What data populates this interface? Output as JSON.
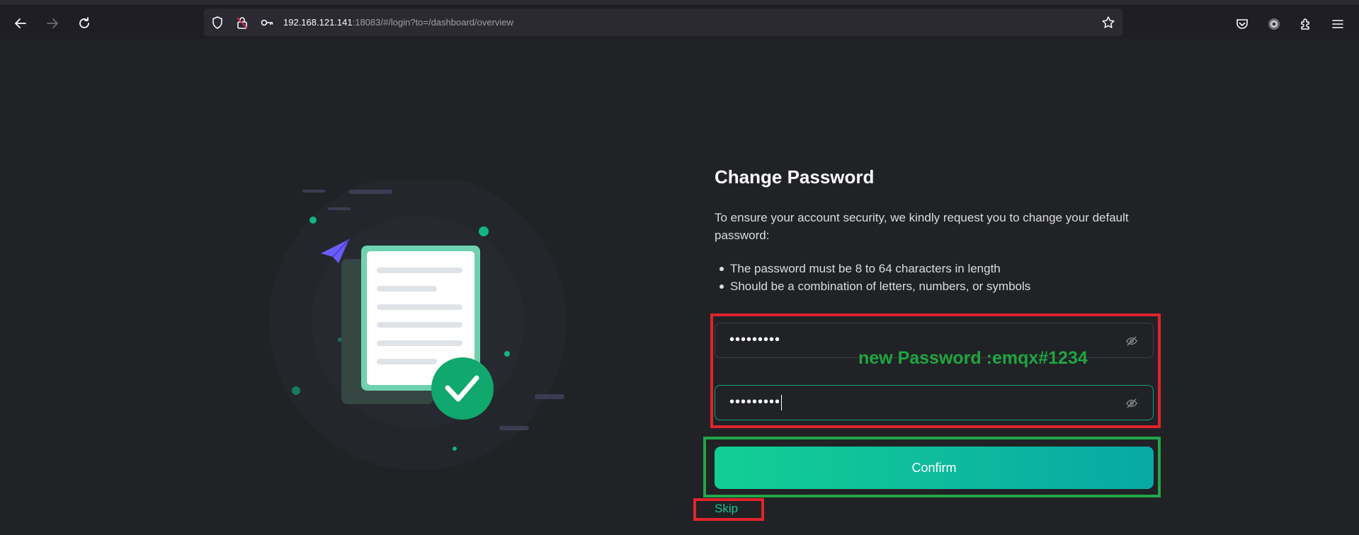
{
  "browser": {
    "url_host": "192.168.121.141",
    "url_rest": ":18083/#/login?to=/dashboard/overview",
    "icons": {
      "back": "back-arrow-icon",
      "forward": "forward-arrow-icon",
      "reload": "reload-icon",
      "shield": "shield-icon",
      "lock": "lock-icon",
      "key": "key-icon",
      "bookmark": "star-icon",
      "pocket": "pocket-icon",
      "account": "account-icon",
      "extensions": "puzzle-icon",
      "menu": "hamburger-menu-icon"
    }
  },
  "page": {
    "title": "Change Password",
    "description": "To ensure your account security, we kindly request you to change your default password:",
    "rules": [
      "The password must be 8 to 64 characters in length",
      "Should be a combination of letters, numbers, or symbols"
    ],
    "new_password": {
      "value": "•••••••••",
      "icon": "eye-slash-icon"
    },
    "confirm_password": {
      "value": "•••••••••",
      "icon": "eye-slash-icon"
    },
    "annotation": "new Password :emqx#1234",
    "confirm_label": "Confirm",
    "skip_label": "Skip"
  },
  "colors": {
    "accent": "#13cf94",
    "background": "#202225",
    "annotation_box_red": "#e0242e",
    "annotation_box_green": "#22a64a"
  }
}
